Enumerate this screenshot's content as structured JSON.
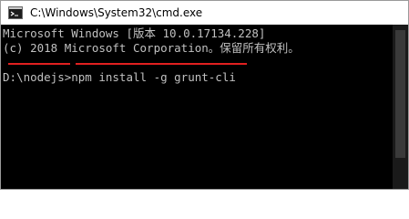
{
  "window": {
    "title": "C:\\Windows\\System32\\cmd.exe"
  },
  "console": {
    "lines": [
      "Microsoft Windows [版本 10.0.17134.228]",
      "(c) 2018 Microsoft Corporation。保留所有权利。",
      "D:\\nodejs>npm install -g grunt-cli"
    ]
  },
  "colors": {
    "console_bg": "#000000",
    "console_fg": "#c0c0c0",
    "underline_annotation": "#e02020"
  },
  "icons": {
    "app": "cmd-icon"
  }
}
